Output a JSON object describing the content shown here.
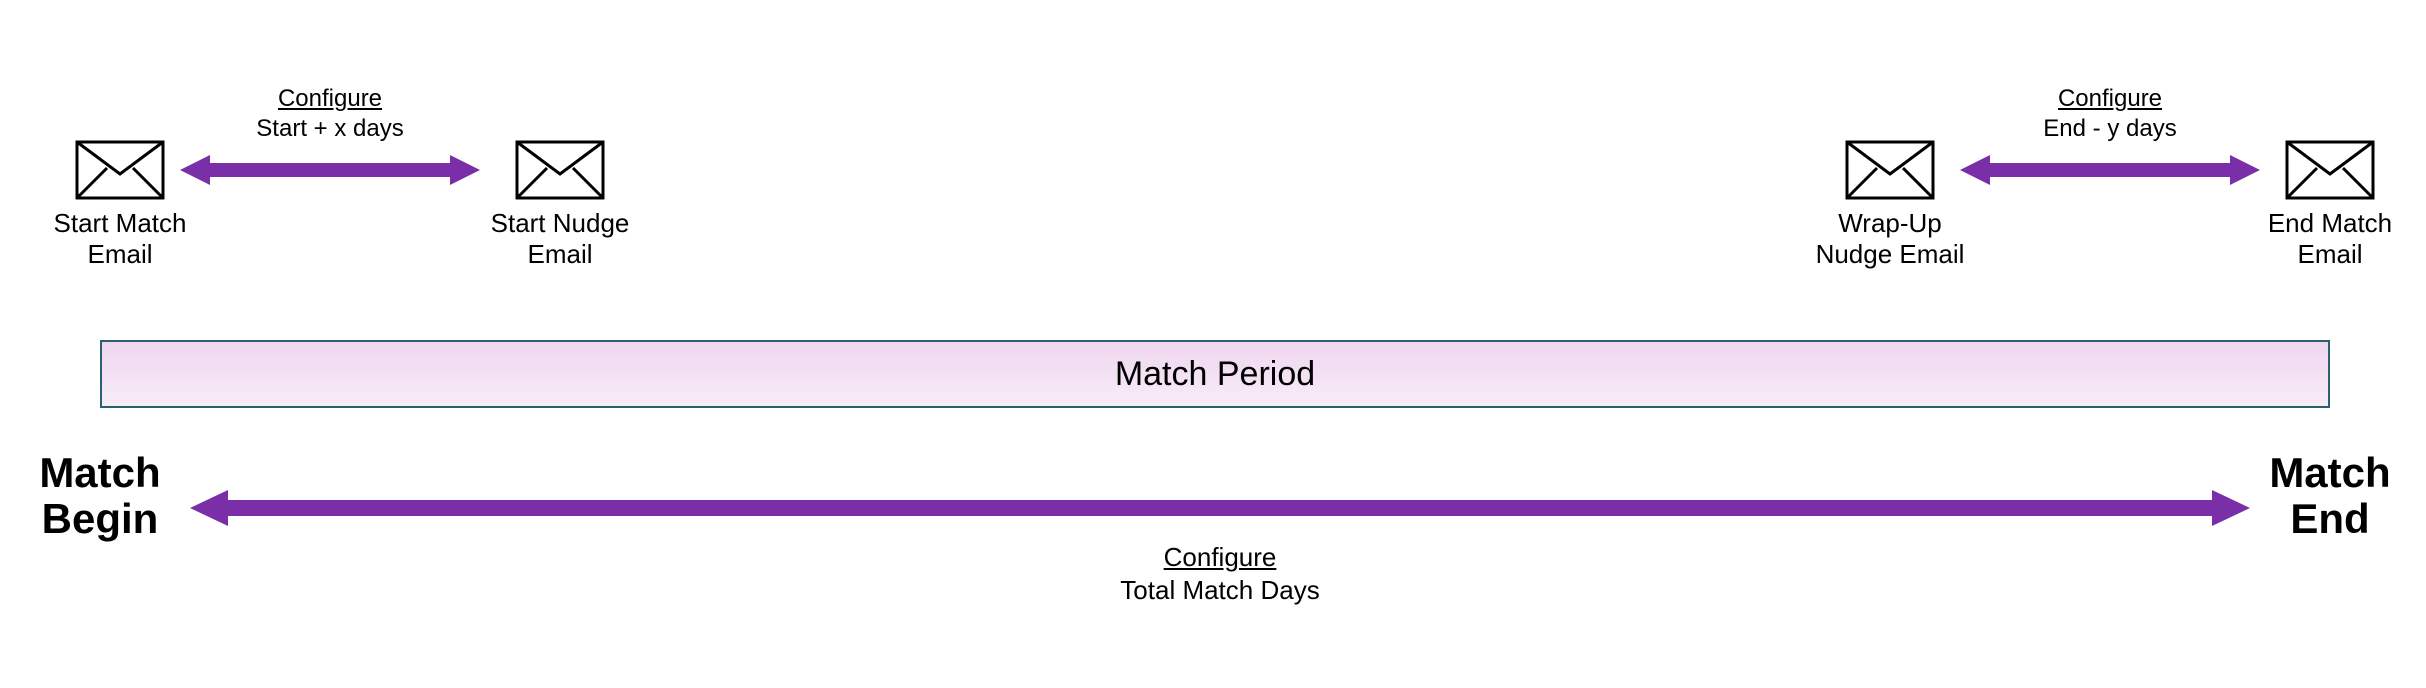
{
  "emails": {
    "startMatch": {
      "line1": "Start Match",
      "line2": "Email"
    },
    "startNudge": {
      "line1": "Start Nudge",
      "line2": "Email"
    },
    "wrapUp": {
      "line1": "Wrap-Up",
      "line2": "Nudge Email"
    },
    "endMatch": {
      "line1": "End Match",
      "line2": "Email"
    }
  },
  "topAnnot": {
    "left": {
      "configure": "Configure",
      "sub": "Start + x days"
    },
    "right": {
      "configure": "Configure",
      "sub": "End - y days"
    }
  },
  "matchPeriod": {
    "label": "Match Period"
  },
  "bigLabels": {
    "begin": {
      "line1": "Match",
      "line2": "Begin"
    },
    "end": {
      "line1": "Match",
      "line2": "End"
    }
  },
  "bottomAnnot": {
    "configure": "Configure",
    "sub": "Total Match Days"
  },
  "colors": {
    "arrow": "#7a2ea8",
    "periodBorder": "#2b6070"
  }
}
